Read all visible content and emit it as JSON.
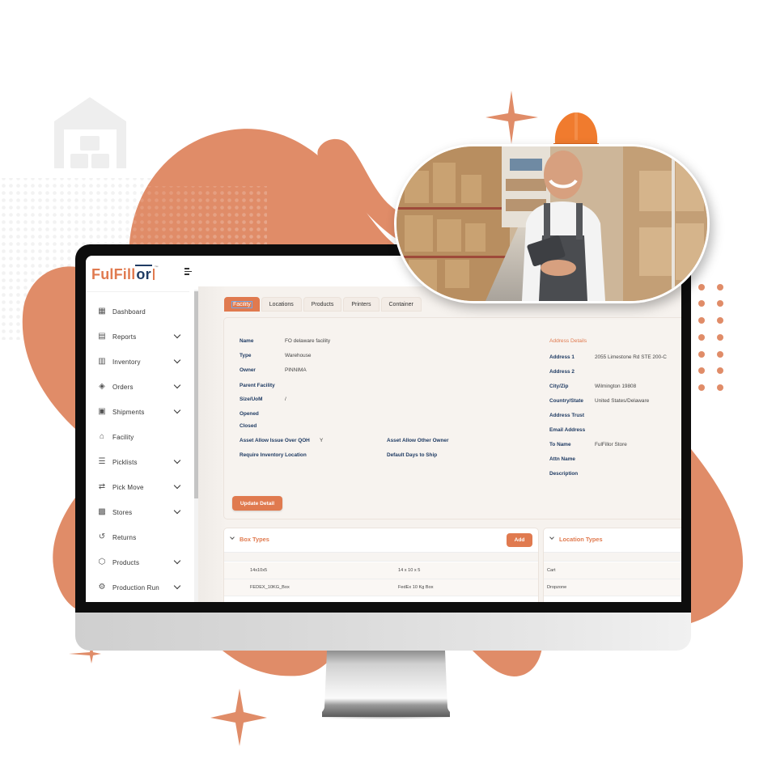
{
  "brand": {
    "name_part1": "FulFill",
    "name_part2": "or",
    "accent_color": "#e07a4f",
    "navy_color": "#1f3b63"
  },
  "header": {
    "menu_toggle_icon": "menu-collapse-icon"
  },
  "sidebar": {
    "items": [
      {
        "label": "Dashboard",
        "icon": "dashboard-icon",
        "glyph": "▦",
        "expandable": false
      },
      {
        "label": "Reports",
        "icon": "reports-icon",
        "glyph": "▤",
        "expandable": true
      },
      {
        "label": "Inventory",
        "icon": "inventory-icon",
        "glyph": "▥",
        "expandable": true
      },
      {
        "label": "Orders",
        "icon": "orders-icon",
        "glyph": "◈",
        "expandable": true
      },
      {
        "label": "Shipments",
        "icon": "shipments-icon",
        "glyph": "▣",
        "expandable": true
      },
      {
        "label": "Facility",
        "icon": "facility-icon",
        "glyph": "⌂",
        "expandable": false
      },
      {
        "label": "Picklists",
        "icon": "picklists-icon",
        "glyph": "☰",
        "expandable": true
      },
      {
        "label": "Pick Move",
        "icon": "pick-move-icon",
        "glyph": "⇄",
        "expandable": true
      },
      {
        "label": "Stores",
        "icon": "stores-icon",
        "glyph": "▩",
        "expandable": true
      },
      {
        "label": "Returns",
        "icon": "returns-icon",
        "glyph": "↺",
        "expandable": false
      },
      {
        "label": "Products",
        "icon": "products-icon",
        "glyph": "⬡",
        "expandable": true
      },
      {
        "label": "Production Run",
        "icon": "production-run-icon",
        "glyph": "⚙",
        "expandable": true
      }
    ]
  },
  "tabs": [
    {
      "label": "Facility",
      "active": true
    },
    {
      "label": "Locations",
      "active": false
    },
    {
      "label": "Products",
      "active": false
    },
    {
      "label": "Printers",
      "active": false
    },
    {
      "label": "Container",
      "active": false
    }
  ],
  "facility_details": {
    "fields": [
      {
        "label": "Name",
        "value": "FO delaware facility"
      },
      {
        "label": "Type",
        "value": "Warehouse"
      },
      {
        "label": "Owner",
        "value": "PINNIMA"
      },
      {
        "label": "Parent Facility",
        "value": ""
      },
      {
        "label": "Size/UoM",
        "value": "/"
      },
      {
        "label": "Opened",
        "value": ""
      },
      {
        "label": "Closed",
        "value": ""
      }
    ],
    "asset_allow_issue_over_qoh": {
      "label": "Asset Allow Issue Over QOH",
      "value": "Y"
    },
    "require_inventory_location": {
      "label": "Require Inventory Location",
      "value": ""
    },
    "asset_allow_other_owner": {
      "label": "Asset Allow Other Owner",
      "value": ""
    },
    "default_days_to_ship": {
      "label": "Default Days to Ship",
      "value": ""
    },
    "address_title": "Address Details",
    "address_fields": [
      {
        "label": "Address 1",
        "value": "2055 Limestone Rd STE 200-C"
      },
      {
        "label": "Address 2",
        "value": ""
      },
      {
        "label": "City/Zip",
        "value": "Wilmington 19808"
      },
      {
        "label": "Country/State",
        "value": "United States/Delaware"
      },
      {
        "label": "Address Trust",
        "value": ""
      },
      {
        "label": "Email Address",
        "value": ""
      },
      {
        "label": "To Name",
        "value": "FulFillor Store"
      },
      {
        "label": "Attn Name",
        "value": ""
      },
      {
        "label": "Description",
        "value": ""
      }
    ],
    "update_button": "Update Detail"
  },
  "box_types": {
    "title": "Box Types",
    "add_button": "Add",
    "rows": [
      {
        "id": "14x10x5",
        "description": "14 x 10 x 5"
      },
      {
        "id": "FEDEX_10KG_Box",
        "description": "FedEx 10 Kg Box"
      }
    ]
  },
  "location_types": {
    "title": "Location Types",
    "rows": [
      {
        "name": "Cart"
      },
      {
        "name": "Dropzone"
      }
    ]
  },
  "decor": {
    "photo_alt": "Smiling warehouse worker in orange hard hat holding a tablet",
    "warehouse_icon": "warehouse-icon"
  }
}
